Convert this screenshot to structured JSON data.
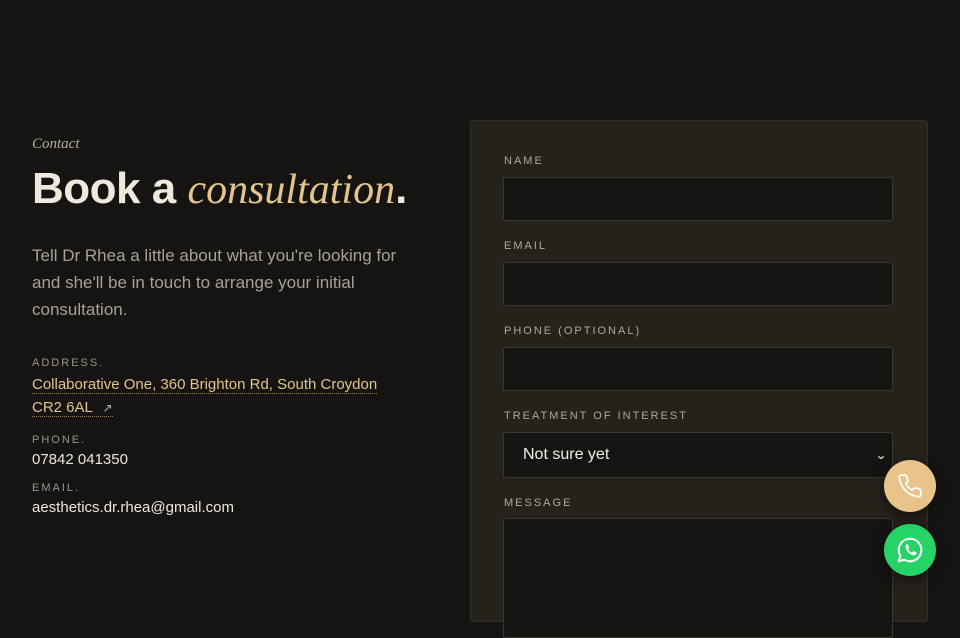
{
  "contact": {
    "eyebrow": "Contact",
    "heading_pre": "Book a",
    "heading_accent": "consultation",
    "heading_post": ".",
    "intro": "Tell Dr Rhea a little about what you're looking for and she'll be in touch to arrange your initial consultation.",
    "address_label": "ADDRESS.",
    "address": "Collaborative One, 360 Brighton Rd, South Croydon CR2 6AL",
    "address_arrow": "↗",
    "phone_label": "PHONE.",
    "phone": "07842 041350",
    "email_label": "EMAIL.",
    "email": "aesthetics.dr.rhea@gmail.com"
  },
  "form": {
    "name_label": "NAME",
    "name_value": "",
    "email_label": "EMAIL",
    "email_value": "",
    "phone_label": "PHONE (OPTIONAL)",
    "phone_value": "",
    "treatment_label": "TREATMENT OF INTEREST",
    "treatment_selected": "Not sure yet",
    "message_label": "MESSAGE",
    "message_value": ""
  },
  "fabs": {
    "call_icon": "phone-icon",
    "call_color": "#e9c48a",
    "whatsapp_icon": "whatsapp-icon",
    "whatsapp_color": "#25d366"
  },
  "theme": {
    "background": "#161412",
    "accent": "#e2c48c",
    "card": "#25211b"
  }
}
